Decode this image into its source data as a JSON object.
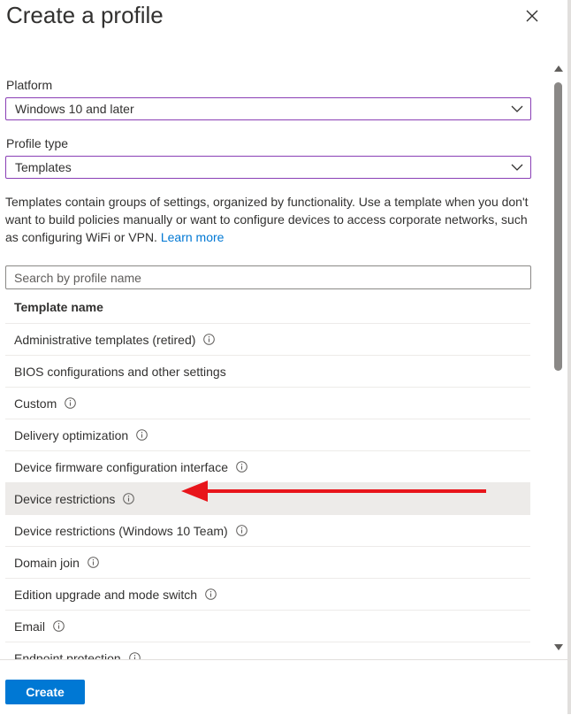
{
  "header": {
    "title": "Create a profile"
  },
  "platform": {
    "label": "Platform",
    "value": "Windows 10 and later"
  },
  "profile_type": {
    "label": "Profile type",
    "value": "Templates"
  },
  "description": {
    "text": "Templates contain groups of settings, organized by functionality. Use a template when you don't want to build policies manually or want to configure devices to access corporate networks, such as configuring WiFi or VPN.",
    "link": "Learn more"
  },
  "search": {
    "placeholder": "Search by profile name"
  },
  "list": {
    "header": "Template name",
    "items": [
      {
        "label": "Administrative templates (retired)",
        "info": true
      },
      {
        "label": "BIOS configurations and other settings",
        "info": false
      },
      {
        "label": "Custom",
        "info": true
      },
      {
        "label": "Delivery optimization",
        "info": true
      },
      {
        "label": "Device firmware configuration interface",
        "info": true
      },
      {
        "label": "Device restrictions",
        "info": true,
        "selected": true
      },
      {
        "label": "Device restrictions (Windows 10 Team)",
        "info": true
      },
      {
        "label": "Domain join",
        "info": true
      },
      {
        "label": "Edition upgrade and mode switch",
        "info": true
      },
      {
        "label": "Email",
        "info": true
      },
      {
        "label": "Endpoint protection",
        "info": true
      }
    ]
  },
  "footer": {
    "create_label": "Create"
  },
  "colors": {
    "accent": "#0078d4",
    "select_border": "#8a3fb5",
    "selected_row": "#edebe9",
    "arrow": "#e8151b"
  },
  "annotation": {
    "type": "arrow",
    "points_to": "Device restrictions"
  }
}
